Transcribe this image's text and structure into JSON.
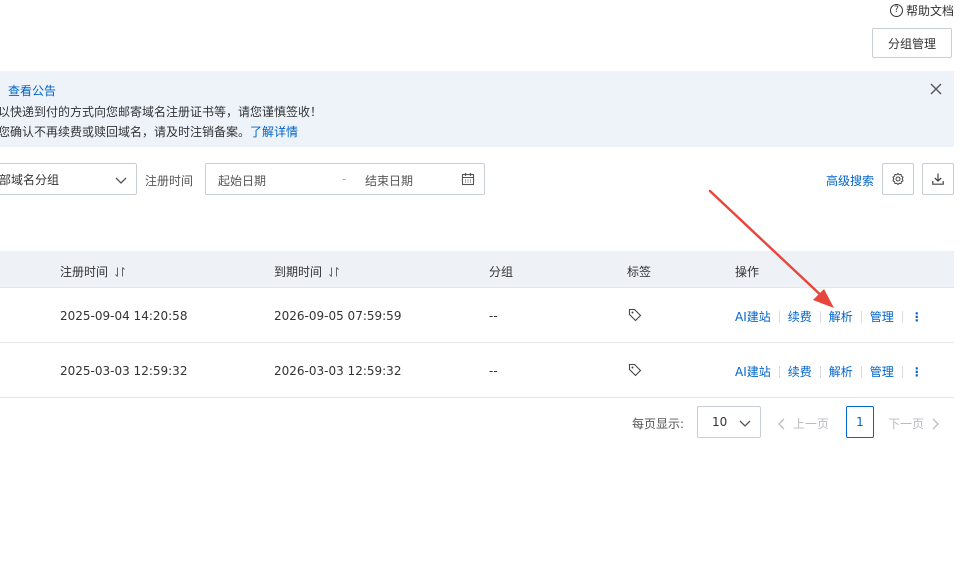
{
  "header": {
    "help_label": "帮助文档",
    "group_manage_label": "分组管理"
  },
  "notice": {
    "title": "查看公告",
    "line1": "以快递到付的方式向您邮寄域名注册证书等，请您谨慎签收！",
    "line2_text": "您确认不再续费或赎回域名，请及时注销备案。",
    "line2_link": "了解详情"
  },
  "filters": {
    "group_select_value": "部域名分组",
    "reg_time_label": "注册时间",
    "start_placeholder": "起始日期",
    "separator": "-",
    "end_placeholder": "结束日期",
    "advanced_search": "高级搜索"
  },
  "table": {
    "columns": {
      "reg_time": "注册时间",
      "expire_time": "到期时间",
      "group": "分组",
      "tags": "标签",
      "actions": "操作"
    },
    "rows": [
      {
        "reg_time": "2025-09-04 14:20:58",
        "expire_time": "2026-09-05 07:59:59",
        "group": "--",
        "actions": [
          "AI建站",
          "续费",
          "解析",
          "管理"
        ]
      },
      {
        "reg_time": "2025-03-03 12:59:32",
        "expire_time": "2026-03-03 12:59:32",
        "group": "--",
        "actions": [
          "AI建站",
          "续费",
          "解析",
          "管理"
        ]
      }
    ]
  },
  "pagination": {
    "per_page_label": "每页显示:",
    "per_page_value": "10",
    "prev_label": "上一页",
    "current_page": "1",
    "next_label": "下一页"
  },
  "colors": {
    "accent": "#0064c8",
    "annotation_arrow": "#e8453c",
    "notice_bg": "#edf3f9"
  }
}
